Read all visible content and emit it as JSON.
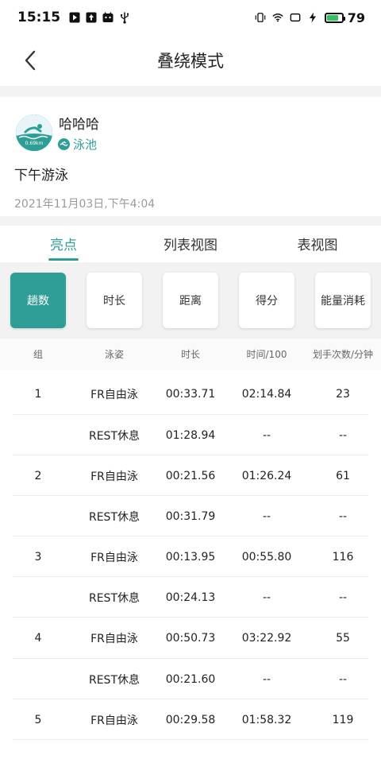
{
  "status_bar": {
    "time": "15:15",
    "battery_level": "79",
    "battery_fill": 0.79,
    "accent_battery": "#35c25e"
  },
  "header": {
    "title": "叠绕模式",
    "back_icon": "chevron-left-icon"
  },
  "post": {
    "username": "哈哈哈",
    "sport_tag": "泳池",
    "title": "下午游泳",
    "date": "2021年11月03日,下午4:04",
    "avatar_icon": "swimmer-icon",
    "avatar_badge": "0.69km"
  },
  "tabs": [
    {
      "label": "亮点",
      "active": true
    },
    {
      "label": "列表视图",
      "active": false
    },
    {
      "label": "表视图",
      "active": false
    }
  ],
  "filters": [
    {
      "label": "趟数",
      "active": true
    },
    {
      "label": "时长",
      "active": false
    },
    {
      "label": "距离",
      "active": false
    },
    {
      "label": "得分",
      "active": false
    },
    {
      "label": "能量消耗",
      "active": false
    }
  ],
  "table": {
    "columns": [
      "组",
      "泳姿",
      "时长",
      "时间/100",
      "划手次数/分钟"
    ],
    "rows": [
      [
        "1",
        "FR自由泳",
        "00:33.71",
        "02:14.84",
        "23"
      ],
      [
        "",
        "REST休息",
        "01:28.94",
        "--",
        "--"
      ],
      [
        "2",
        "FR自由泳",
        "00:21.56",
        "01:26.24",
        "61"
      ],
      [
        "",
        "REST休息",
        "00:31.79",
        "--",
        "--"
      ],
      [
        "3",
        "FR自由泳",
        "00:13.95",
        "00:55.80",
        "116"
      ],
      [
        "",
        "REST休息",
        "00:24.13",
        "--",
        "--"
      ],
      [
        "4",
        "FR自由泳",
        "00:50.73",
        "03:22.92",
        "55"
      ],
      [
        "",
        "REST休息",
        "00:21.60",
        "--",
        "--"
      ],
      [
        "5",
        "FR自由泳",
        "00:29.58",
        "01:58.32",
        "119"
      ]
    ]
  },
  "colors": {
    "accent": "#2f9e97",
    "page_bg": "#f3f3f3",
    "muted_text": "#9a9a9a"
  }
}
